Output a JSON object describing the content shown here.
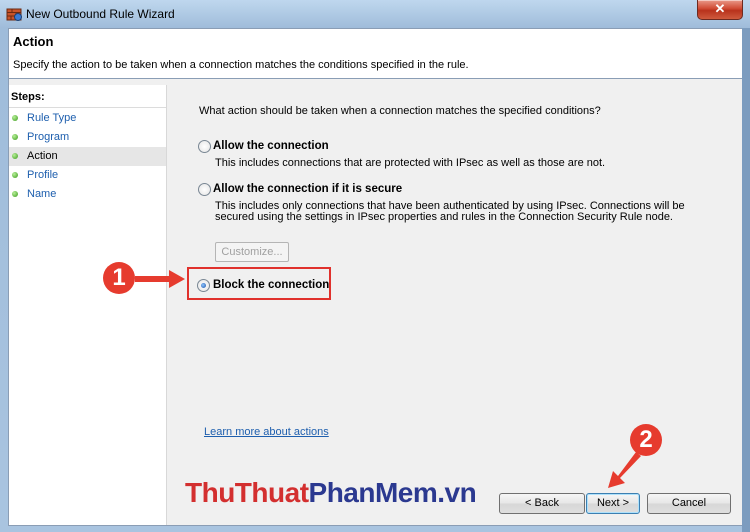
{
  "window": {
    "title": "New Outbound Rule Wizard",
    "close_glyph": "✕"
  },
  "header": {
    "title": "Action",
    "description": "Specify the action to be taken when a connection matches the conditions specified in the rule."
  },
  "steps": {
    "heading": "Steps:",
    "items": [
      {
        "label": "Rule Type"
      },
      {
        "label": "Program"
      },
      {
        "label": "Action",
        "current": true
      },
      {
        "label": "Profile"
      },
      {
        "label": "Name"
      }
    ]
  },
  "main": {
    "question": "What action should be taken when a connection matches the specified conditions?",
    "options": [
      {
        "label": "Allow the connection",
        "description": [
          "This includes connections that are protected with IPsec as well as those are not."
        ],
        "selected": false
      },
      {
        "label": "Allow the connection if it is secure",
        "description": [
          "This includes only connections that have been authenticated by using IPsec.  Connections will be",
          "secured using the settings in IPsec properties and rules in the Connection Security Rule node."
        ],
        "selected": false
      },
      {
        "label": "Block the connection",
        "description": [],
        "selected": true
      }
    ],
    "customize_label": "Customize...",
    "learn_more": "Learn more about actions"
  },
  "buttons": {
    "back": "< Back",
    "next": "Next >",
    "cancel": "Cancel"
  },
  "annotations": {
    "badge1": "1",
    "badge2": "2",
    "color": "#e63b2e"
  },
  "watermark": {
    "part1": "ThuThuat",
    "part2": "PhanMem",
    "part3": ".vn"
  }
}
